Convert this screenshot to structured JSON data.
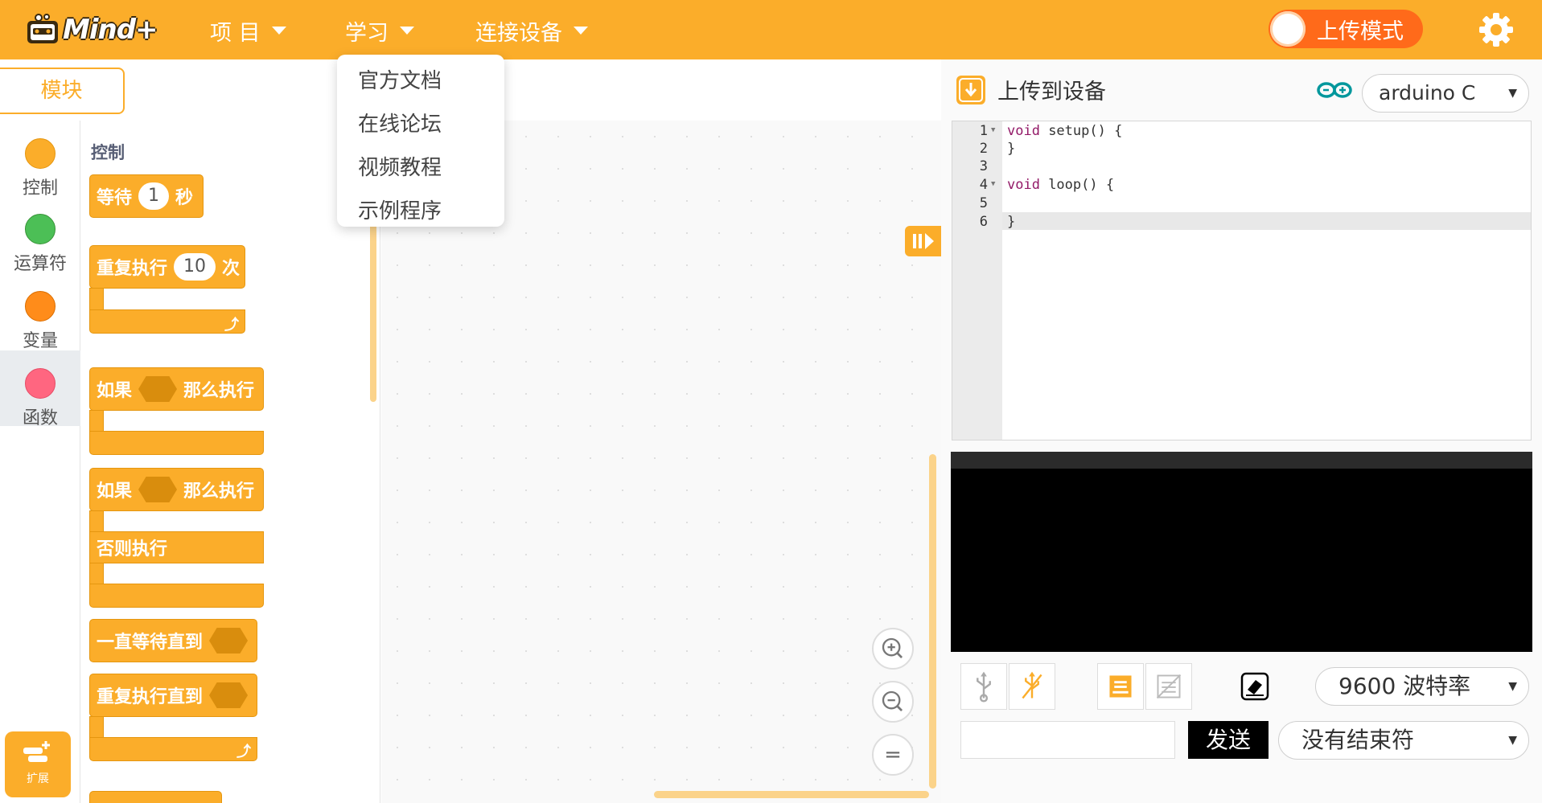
{
  "header": {
    "logo_text": "Mind+",
    "menus": [
      {
        "label": "项 目"
      },
      {
        "label": "学习"
      },
      {
        "label": "连接设备"
      }
    ],
    "upload_mode_label": "上传模式",
    "colors": {
      "bar": "#fbad2a",
      "toggle": "#ff6a1a"
    }
  },
  "learn_dropdown": {
    "items": [
      "官方文档",
      "在线论坛",
      "视频教程",
      "示例程序"
    ]
  },
  "sidebar": {
    "tab_label": "模块",
    "categories": [
      {
        "label": "控制",
        "color": "#fbad2a"
      },
      {
        "label": "运算符",
        "color": "#4cbf56"
      },
      {
        "label": "变量",
        "color": "#ff8c1a"
      },
      {
        "label": "函数",
        "color": "#ff6680"
      }
    ],
    "selected_category": "函数",
    "extension_label": "扩展"
  },
  "palette": {
    "title": "控制",
    "blocks": {
      "wait": {
        "prefix": "等待",
        "value": "1",
        "suffix": "秒"
      },
      "repeat": {
        "prefix": "重复执行",
        "value": "10",
        "suffix": "次"
      },
      "if_then": {
        "prefix": "如果",
        "suffix": "那么执行"
      },
      "if_else": {
        "prefix": "如果",
        "suffix": "那么执行",
        "else": "否则执行"
      },
      "wait_until": {
        "label": "一直等待直到"
      },
      "repeat_until": {
        "label": "重复执行直到"
      }
    },
    "loop_arrow": "⤴"
  },
  "workspace": {
    "zoom_in": "+",
    "zoom_out": "−",
    "zoom_reset": "="
  },
  "code_panel": {
    "upload_label": "上传到设备",
    "board": "arduino C",
    "lines": [
      {
        "n": "1",
        "kw": "void",
        "rest": " setup() {"
      },
      {
        "n": "2",
        "kw": "",
        "rest": "}"
      },
      {
        "n": "3",
        "kw": "",
        "rest": ""
      },
      {
        "n": "4",
        "kw": "void",
        "rest": " loop() {"
      },
      {
        "n": "5",
        "kw": "",
        "rest": ""
      },
      {
        "n": "6",
        "kw": "",
        "rest": "}"
      }
    ]
  },
  "serial": {
    "baud": "9600 波特率",
    "send_label": "发送",
    "send_value": "",
    "line_ending": "没有结束符"
  }
}
